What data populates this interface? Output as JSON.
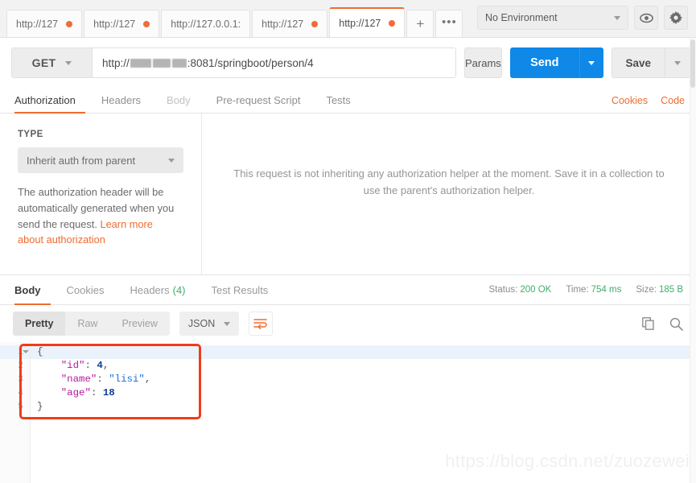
{
  "tabbar": {
    "request_tabs": [
      {
        "label": "http://127",
        "dot": true,
        "active": false,
        "truncated": false
      },
      {
        "label": "http://127",
        "dot": true,
        "active": false,
        "truncated": false
      },
      {
        "label": "http://127.0.0.1:",
        "dot": false,
        "active": false,
        "truncated": true
      },
      {
        "label": "http://127",
        "dot": true,
        "active": false,
        "truncated": false
      },
      {
        "label": "http://127",
        "dot": true,
        "active": true,
        "truncated": false
      }
    ],
    "new_tab_label": "+",
    "more_tabs_label": "•••",
    "environment": "No Environment",
    "eye_icon": "eye-icon",
    "gear_icon": "gear-icon"
  },
  "request": {
    "method": "GET",
    "url_prefix": "http://",
    "url_suffix": ":8081/springboot/person/4",
    "url_full": "http://[redacted]:8081/springboot/person/4",
    "params_label": "Params",
    "send_label": "Send",
    "save_label": "Save"
  },
  "request_tabs": {
    "items": [
      {
        "label": "Authorization",
        "state": "active"
      },
      {
        "label": "Headers",
        "state": "normal"
      },
      {
        "label": "Body",
        "state": "dim"
      },
      {
        "label": "Pre-request Script",
        "state": "normal"
      },
      {
        "label": "Tests",
        "state": "normal"
      }
    ],
    "cookies_link": "Cookies",
    "code_link": "Code"
  },
  "auth": {
    "type_label": "TYPE",
    "type_value": "Inherit auth from parent",
    "description_text": "The authorization header will be automatically generated when you send the request. ",
    "description_link": "Learn more about authorization",
    "center_message": "This request is not inheriting any authorization helper at the moment. Save it in a collection to use the parent's authorization helper."
  },
  "response": {
    "tabs": [
      {
        "label": "Body",
        "state": "active",
        "count": ""
      },
      {
        "label": "Cookies",
        "state": "normal",
        "count": ""
      },
      {
        "label": "Headers",
        "state": "normal",
        "count": "(4)"
      },
      {
        "label": "Test Results",
        "state": "normal",
        "count": ""
      }
    ],
    "status_label": "Status:",
    "status_value": "200 OK",
    "time_label": "Time:",
    "time_value": "754 ms",
    "size_label": "Size:",
    "size_value": "185 B",
    "view_modes": [
      {
        "label": "Pretty",
        "on": true
      },
      {
        "label": "Raw",
        "on": false
      },
      {
        "label": "Preview",
        "on": false
      }
    ],
    "format": "JSON",
    "wrap_icon": "word-wrap-icon",
    "copy_icon": "copy-icon",
    "search_icon": "search-icon",
    "body_lines": [
      {
        "num": "1",
        "segments": [
          {
            "t": "{",
            "c": "p"
          }
        ]
      },
      {
        "num": "2",
        "segments": [
          {
            "t": "    ",
            "c": "p"
          },
          {
            "t": "\"id\"",
            "c": "k2"
          },
          {
            "t": ": ",
            "c": "p"
          },
          {
            "t": "4",
            "c": "n"
          },
          {
            "t": ",",
            "c": "p"
          }
        ]
      },
      {
        "num": "3",
        "segments": [
          {
            "t": "    ",
            "c": "p"
          },
          {
            "t": "\"name\"",
            "c": "k2"
          },
          {
            "t": ": ",
            "c": "p"
          },
          {
            "t": "\"lisi\"",
            "c": "s"
          },
          {
            "t": ",",
            "c": "p"
          }
        ]
      },
      {
        "num": "4",
        "segments": [
          {
            "t": "    ",
            "c": "p"
          },
          {
            "t": "\"age\"",
            "c": "k2"
          },
          {
            "t": ": ",
            "c": "p"
          },
          {
            "t": "18",
            "c": "n"
          }
        ]
      },
      {
        "num": "5",
        "segments": [
          {
            "t": "}",
            "c": "p"
          }
        ]
      }
    ]
  },
  "watermark": "https://blog.csdn.net/zuozewei",
  "colors": {
    "accent_orange": "#ef6c2f",
    "send_blue": "#0f88e8",
    "status_green": "#3fae6b",
    "annotation_red": "#f03c18"
  }
}
